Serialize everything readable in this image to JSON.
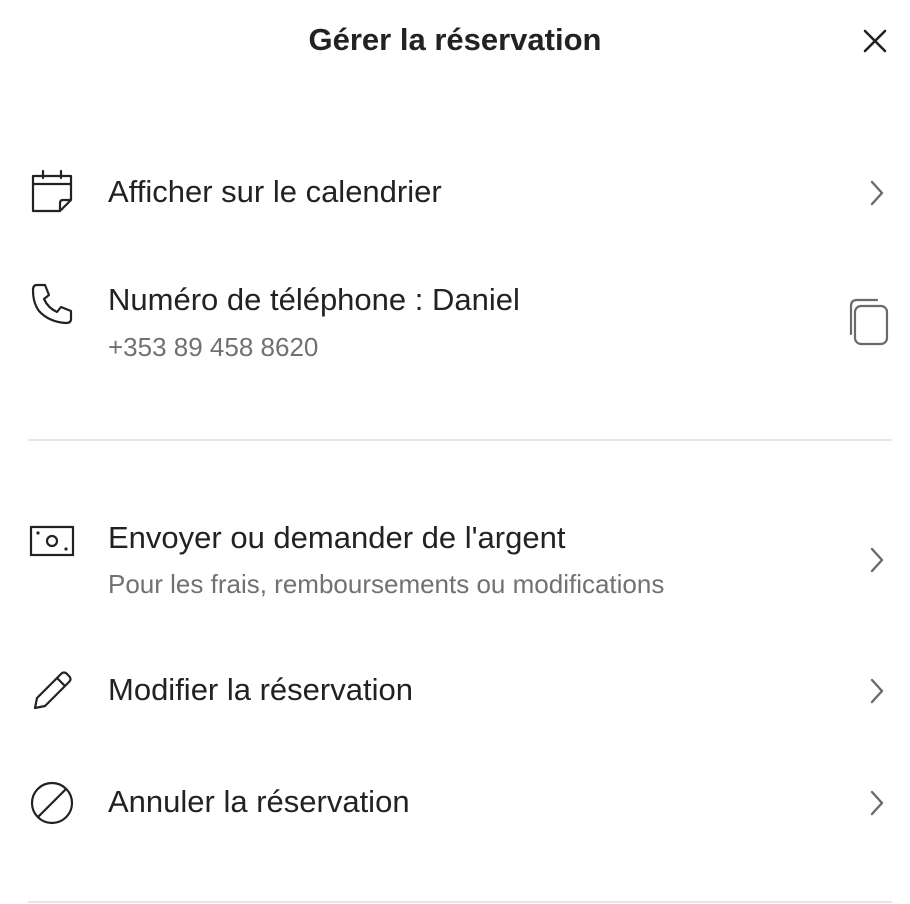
{
  "header": {
    "title": "Gérer la réservation",
    "close_icon": "close-icon"
  },
  "section1": {
    "calendar": {
      "icon": "calendar-icon",
      "label": "Afficher sur le calendrier",
      "chevron_icon": "chevron-right-icon"
    },
    "phone": {
      "icon": "phone-icon",
      "label": "Numéro de téléphone : Daniel",
      "number": "+353 89 458 8620",
      "copy_icon": "copy-icon"
    }
  },
  "section2": {
    "money": {
      "icon": "money-icon",
      "label": "Envoyer ou demander de l'argent",
      "subtitle": "Pour les frais, remboursements ou modifications",
      "chevron_icon": "chevron-right-icon"
    },
    "modify": {
      "icon": "pencil-icon",
      "label": "Modifier la réservation",
      "chevron_icon": "chevron-right-icon"
    },
    "cancel": {
      "icon": "cancel-icon",
      "label": "Annuler la réservation",
      "chevron_icon": "chevron-right-icon"
    }
  },
  "colors": {
    "text_primary": "#222222",
    "text_secondary": "#717171",
    "divider": "#e6e6e6",
    "background": "#ffffff"
  }
}
